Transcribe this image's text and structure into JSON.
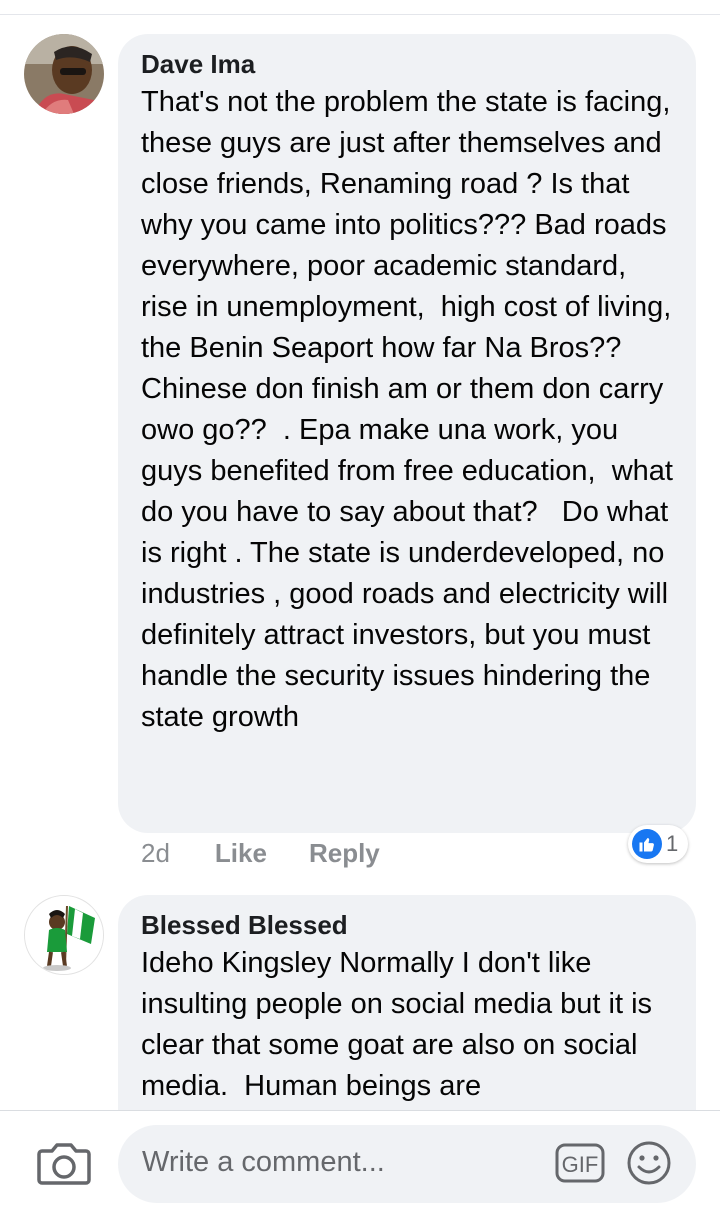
{
  "comments": [
    {
      "author": "Dave Ima",
      "text": "That's not the problem the state is facing, these guys are just after themselves and close friends, Renaming road ? Is that why you came into politics??? Bad roads everywhere, poor academic standard, rise in unemployment,  high cost of living, the Benin Seaport how far Na Bros?? Chinese don finish am or them don carry owo go??  . Epa make una work, you guys benefited from free education,  what do you have to say about that?   Do what is right . The state is underdeveloped, no industries , good roads and electricity will definitely attract investors, but you must handle the security issues hindering the state growth",
      "time": "2d",
      "like_label": "Like",
      "reply_label": "Reply",
      "reaction_count": "1",
      "reaction_icon": "like-icon"
    },
    {
      "author": "Blessed Blessed",
      "text": "Ideho Kingsley Normally I don't like insulting people on social media but it is clear that some goat are also on social media.  Human beings are"
    }
  ],
  "composer": {
    "placeholder": "Write a comment...",
    "gif_label": "GIF",
    "camera_icon": "camera-icon",
    "emoji_icon": "emoji-icon"
  },
  "colors": {
    "bubble": "#f0f2f5",
    "like_blue": "#1877f2",
    "muted": "#8a8d91"
  }
}
